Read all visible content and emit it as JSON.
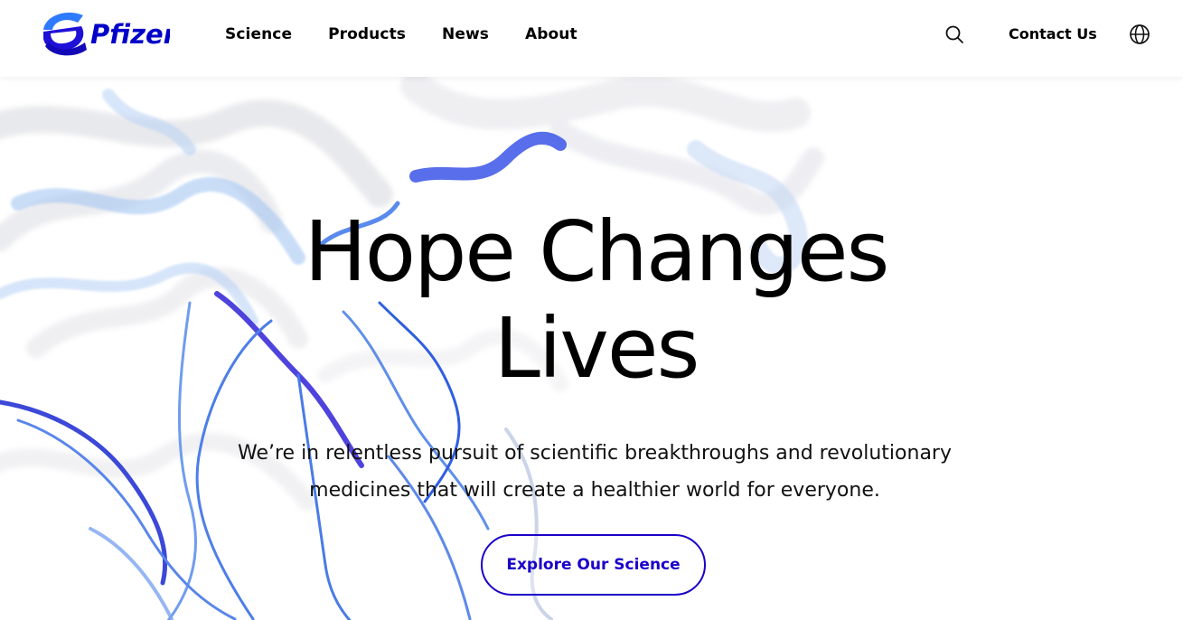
{
  "header": {
    "logo_text": "Pfizer",
    "nav": [
      {
        "label": "Science"
      },
      {
        "label": "Products"
      },
      {
        "label": "News"
      },
      {
        "label": "About"
      }
    ],
    "search_icon": "search-icon",
    "contact_label": "Contact Us",
    "language_icon": "globe-icon"
  },
  "hero": {
    "headline_line1": "Hope Changes",
    "headline_line2": "Lives",
    "subtext_line1": "We’re in relentless pursuit of scientific breakthroughs and revolutionary",
    "subtext_line2": "medicines that will create a healthier world for everyone.",
    "cta_label": "Explore Our Science"
  },
  "colors": {
    "brand_blue": "#0000c9",
    "cta_blue": "#1a00c9",
    "logo_light_blue": "#3a8dff"
  }
}
